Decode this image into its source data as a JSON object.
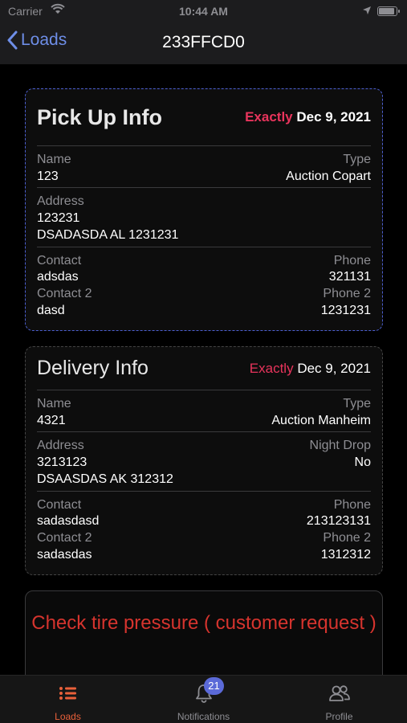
{
  "status_bar": {
    "carrier": "Carrier",
    "time": "10:44 AM"
  },
  "nav": {
    "back_label": "Loads",
    "title": "233FFCD0"
  },
  "pickup": {
    "title": "Pick Up Info",
    "date_qualifier": "Exactly",
    "date": "Dec 9, 2021",
    "name_label": "Name",
    "name": "123",
    "type_label": "Type",
    "type": "Auction Copart",
    "address_label": "Address",
    "address_line1": "123231",
    "address_line2": "DSADASDA AL 1231231",
    "contact_label": "Contact",
    "contact": "adsdas",
    "phone_label": "Phone",
    "phone": "321131",
    "contact2_label": "Contact 2",
    "contact2": "dasd",
    "phone2_label": "Phone 2",
    "phone2": "1231231"
  },
  "delivery": {
    "title": "Delivery Info",
    "date_qualifier": "Exactly",
    "date": "Dec 9, 2021",
    "name_label": "Name",
    "name": "4321",
    "type_label": "Type",
    "type": "Auction Manheim",
    "address_label": "Address",
    "address_line1": "3213123",
    "address_line2": "DSAASDAS AK 312312",
    "night_drop_label": "Night Drop",
    "night_drop": "No",
    "contact_label": "Contact",
    "contact": "sadasdasd",
    "phone_label": "Phone",
    "phone": "213123131",
    "contact2_label": "Contact 2",
    "contact2": "sadasdas",
    "phone2_label": "Phone 2",
    "phone2": "1312312"
  },
  "note": {
    "text": "Check tire pressure  ( customer request )"
  },
  "tabs": [
    {
      "label": "Loads",
      "icon": "list-icon",
      "active": true
    },
    {
      "label": "Notifications",
      "icon": "bell-icon",
      "badge": "21"
    },
    {
      "label": "Profile",
      "icon": "people-icon"
    }
  ],
  "colors": {
    "accent_blue": "#6e8ee8",
    "exact_red": "#e8345c",
    "note_red": "#d6342e",
    "tab_active": "#e9603a",
    "badge": "#5b6ad8"
  }
}
